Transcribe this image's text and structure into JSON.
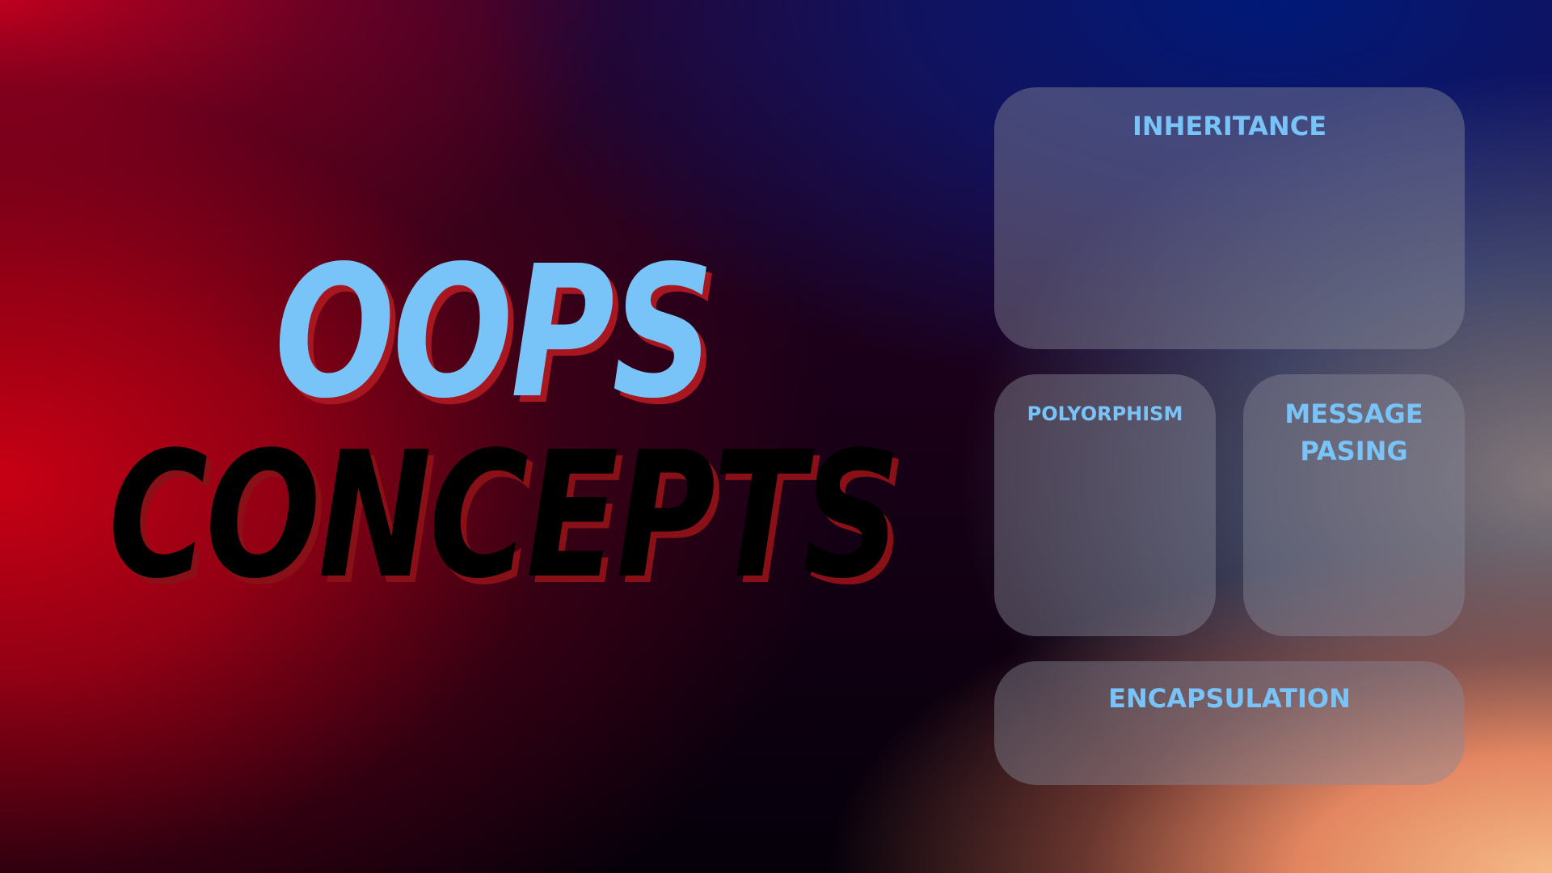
{
  "title": {
    "line1": "OOPS",
    "line2": "CONCEPTS"
  },
  "cards": {
    "inheritance": "INHERITANCE",
    "polymorphism": "POLYORPHISM",
    "message_passing_line1": "MESSAGE",
    "message_passing_line2": "PASING",
    "encapsulation": "ENCAPSULATION"
  },
  "colors": {
    "title_primary": "#78c3f8",
    "title_shadow": "#a81620",
    "title_secondary": "#000000",
    "card_text": "#78c3f8"
  }
}
